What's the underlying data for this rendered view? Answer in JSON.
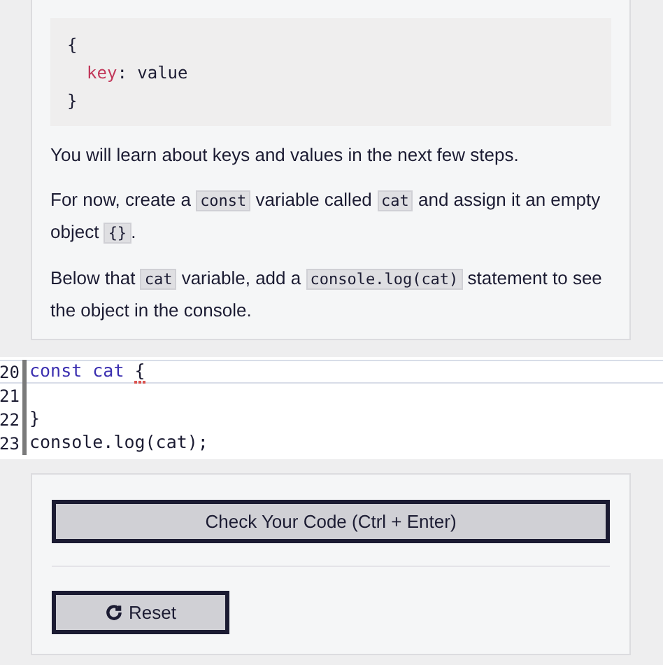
{
  "example_code": {
    "lines": [
      {
        "indent": false,
        "tokens": [
          {
            "text": "{",
            "kind": "plain"
          }
        ]
      },
      {
        "indent": true,
        "tokens": [
          {
            "text": "key",
            "kind": "property"
          },
          {
            "text": ": value",
            "kind": "plain"
          }
        ]
      },
      {
        "indent": false,
        "tokens": [
          {
            "text": "}",
            "kind": "plain"
          }
        ]
      }
    ]
  },
  "paragraphs": [
    [
      {
        "text": "You will learn about keys and values in the next few steps.",
        "code": false
      }
    ],
    [
      {
        "text": "For now, create a ",
        "code": false
      },
      {
        "text": "const",
        "code": true
      },
      {
        "text": " variable called ",
        "code": false
      },
      {
        "text": "cat",
        "code": true
      },
      {
        "text": " and assign it an empty object ",
        "code": false
      },
      {
        "text": "{}",
        "code": true
      },
      {
        "text": ".",
        "code": false
      }
    ],
    [
      {
        "text": "Below that ",
        "code": false
      },
      {
        "text": "cat",
        "code": true
      },
      {
        "text": " variable, add a ",
        "code": false
      },
      {
        "text": "console.log(cat)",
        "code": true
      },
      {
        "text": " statement to see the object in the console.",
        "code": false
      }
    ]
  ],
  "editor": {
    "lines": [
      {
        "number": "20",
        "selected": true,
        "tokens": [
          {
            "text": "const cat ",
            "kind": "keyword",
            "error": false
          },
          {
            "text": "{",
            "kind": "plain",
            "error": true
          }
        ]
      },
      {
        "number": "21",
        "selected": false
      },
      {
        "number": "22",
        "selected": false,
        "tokens": [
          {
            "text": "}",
            "kind": "plain",
            "error": false
          }
        ]
      },
      {
        "number": "23",
        "selected": false,
        "tokens": [
          {
            "text": "console.log(cat);",
            "kind": "plain",
            "error": false
          }
        ]
      }
    ]
  },
  "check_button": {
    "label": "Check Your Code (Ctrl + Enter)"
  },
  "reset_button": {
    "label": "Reset"
  }
}
